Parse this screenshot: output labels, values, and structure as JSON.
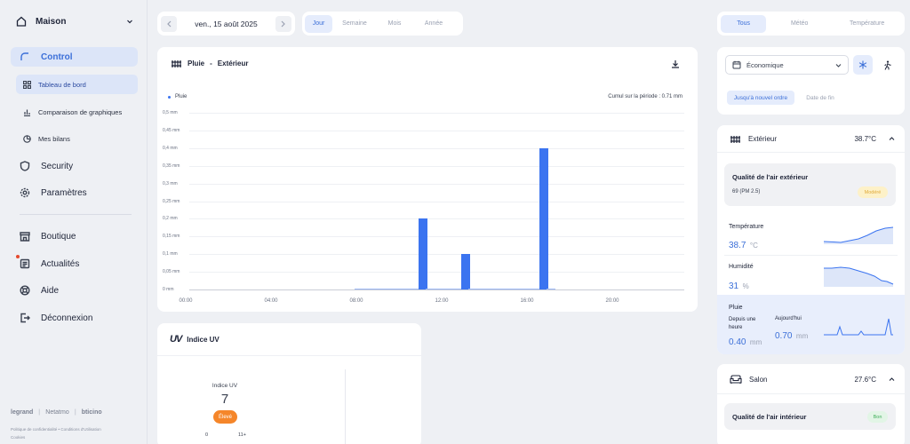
{
  "sidebar": {
    "home": "Maison",
    "control": "Control",
    "sub": [
      "Tableau de bord",
      "Comparaison de graphiques",
      "Mes bilans"
    ],
    "security": "Security",
    "settings": "Paramètres",
    "shop": "Boutique",
    "news": "Actualités",
    "help": "Aide",
    "logout": "Déconnexion",
    "brands": [
      "legrand",
      "Netatmo",
      "bticino"
    ],
    "footer_links": [
      "Politique de confidentialité",
      "Conditions d'Utilisation",
      "Cookies"
    ]
  },
  "datebar": {
    "date": "ven., 15 août 2025",
    "periods": [
      "Jour",
      "Semaine",
      "Mois",
      "Année"
    ],
    "active_period": "Jour"
  },
  "filters": {
    "tabs": [
      "Tous",
      "Météo",
      "Température"
    ],
    "active": "Tous"
  },
  "rain_card": {
    "title": "Pluie",
    "separator": "-",
    "subtitle": "Extérieur",
    "legend": "Pluie",
    "cumul": "Cumul sur la période : 0.71 mm"
  },
  "chart_data": {
    "type": "bar",
    "title": "",
    "xlabel": "",
    "ylabel": "",
    "ylim": [
      0,
      0.5
    ],
    "y_ticks": [
      "0 mm",
      "0,05 mm",
      "0,1 mm",
      "0,15 mm",
      "0,2 mm",
      "0,25 mm",
      "0,3 mm",
      "0,35 mm",
      "0,4 mm",
      "0,45 mm",
      "0,5 mm"
    ],
    "x_ticks": [
      "00:00",
      "04:00",
      "08:00",
      "12:00",
      "16:00",
      "20:00"
    ],
    "x": [
      "08:20",
      "08:40",
      "09:00",
      "09:20",
      "09:40",
      "10:00",
      "10:20",
      "10:40",
      "11:00",
      "11:20",
      "11:40",
      "12:00",
      "12:20",
      "12:40",
      "13:00",
      "13:20",
      "13:40",
      "14:00",
      "14:20",
      "14:40",
      "15:00",
      "15:20",
      "15:40",
      "16:00",
      "16:20",
      "16:40",
      "17:00",
      "17:20"
    ],
    "values": [
      0,
      0,
      0,
      0,
      0,
      0,
      0,
      0,
      0,
      0.2,
      0,
      0,
      0,
      0,
      0,
      0.1,
      0,
      0,
      0,
      0,
      0,
      0,
      0,
      0,
      0,
      0,
      0.4,
      0
    ],
    "series": [
      {
        "name": "Pluie",
        "color": "#3b74f0"
      }
    ]
  },
  "uv_card": {
    "logo": "UV",
    "title": "Indice UV",
    "label": "Indice UV",
    "value": "7",
    "badge": "Élevé",
    "scale_min": "0",
    "scale_max": "11+"
  },
  "mode_panel": {
    "mode": "Économique",
    "until": "Jusqu'à nouvel ordre",
    "end_date": "Date de fin"
  },
  "exterior": {
    "title": "Extérieur",
    "temp": "38.7°C",
    "air_title": "Qualité de l'air extérieur",
    "air_value": "69 (PM 2.5)",
    "air_badge": "Modéré",
    "temperature_label": "Température",
    "temperature_value": "38.7",
    "temperature_unit": "°C",
    "humidity_label": "Humidité",
    "humidity_value": "31",
    "humidity_unit": "%",
    "rain_label": "Pluie",
    "rain_hour_label": "Depuis une heure",
    "rain_hour_value": "0.40",
    "rain_today_label": "Aujourd'hui",
    "rain_today_value": "0.70",
    "rain_unit": "mm"
  },
  "salon": {
    "title": "Salon",
    "temp": "27.6°C",
    "air_title": "Qualité de l'air intérieur",
    "air_badge": "Bon"
  },
  "colors": {
    "accent": "#3b74f0",
    "moderate": "#fdf1c8",
    "good": "#e2f5e6",
    "uv_badge": "#f5862a",
    "news_dot": "#e54b2e"
  }
}
